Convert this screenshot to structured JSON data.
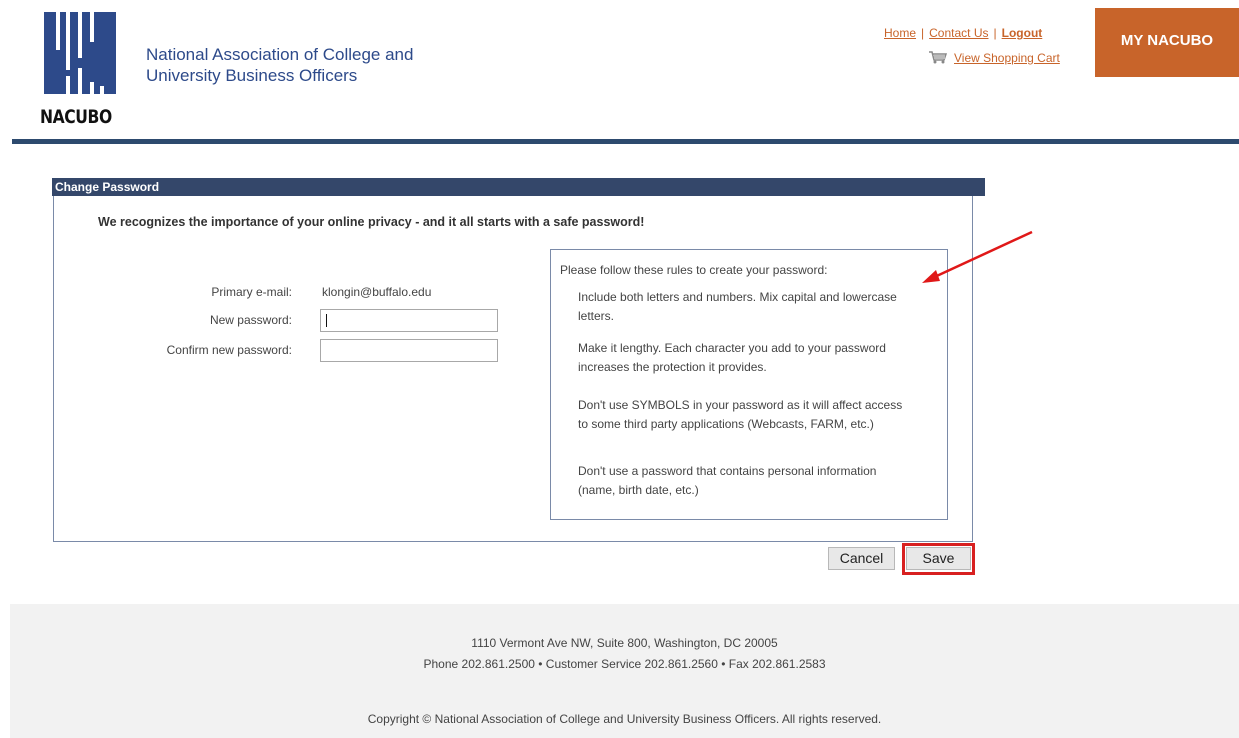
{
  "header": {
    "logo_text": "NACUBO",
    "org_name_line1": "National Association of College and",
    "org_name_line2": "University Business Officers",
    "links": {
      "home": "Home",
      "contact": "Contact Us",
      "logout": "Logout",
      "cart": "View Shopping Cart"
    },
    "my_nacubo": "MY NACUBO"
  },
  "panel": {
    "title": "Change Password",
    "intro": "We recognizes the importance of your online privacy - and it all starts with a safe password!",
    "fields": {
      "email_label": "Primary e-mail:",
      "email_value": "klongin@buffalo.edu",
      "new_password_label": "New password:",
      "new_password_value": "",
      "confirm_password_label": "Confirm new password:",
      "confirm_password_value": ""
    },
    "rules": {
      "title": "Please follow these rules to create your password:",
      "items": [
        "Include both letters and numbers. Mix capital and lowercase letters.",
        "Make it lengthy. Each character you add to your password increases the protection it provides.",
        "Don't use SYMBOLS in your password as it will affect access to some third party applications (Webcasts, FARM, etc.)",
        "Don't use a password that contains personal information (name, birth date, etc.)"
      ]
    },
    "buttons": {
      "cancel": "Cancel",
      "save": "Save"
    }
  },
  "footer": {
    "address": "1110 Vermont Ave NW, Suite 800, Washington, DC 20005",
    "phones": "Phone 202.861.2500 • Customer Service 202.861.2560 • Fax 202.861.2583",
    "copyright": "Copyright © National Association of College and University Business Officers. All rights reserved."
  },
  "colors": {
    "brand_blue": "#2d4a8a",
    "brand_orange": "#c8642a",
    "panel_header": "#34476a",
    "highlight_red": "#d82020"
  }
}
